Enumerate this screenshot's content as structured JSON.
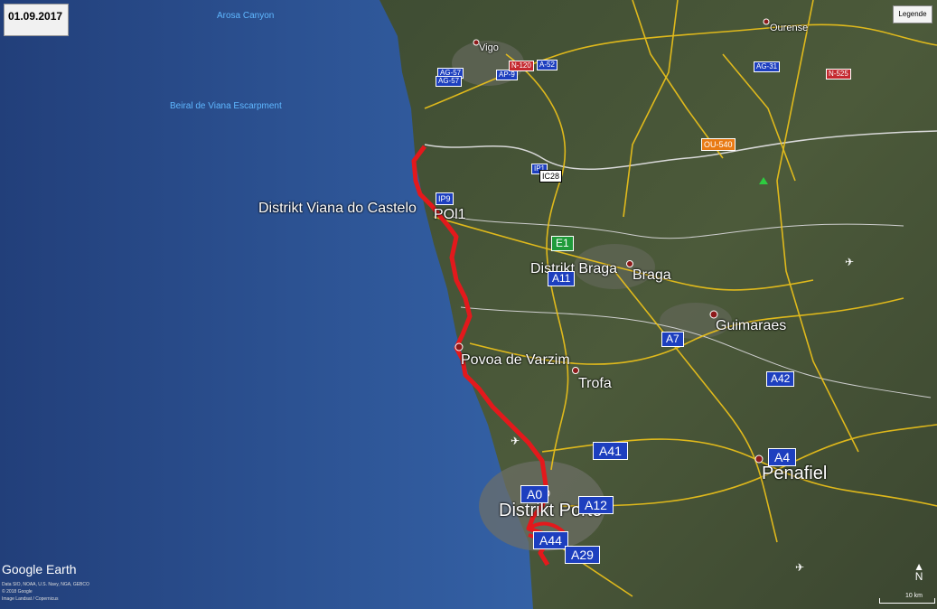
{
  "date": "01.09.2017",
  "legend_label": "Legende",
  "branding": "Google Earth",
  "credits": [
    "Data SIO, NOAA, U.S. Navy, NGA, GEBCO",
    "© 2018 Google",
    "Image Landsat / Copernicus"
  ],
  "scale_label": "10 km",
  "north_label": "N",
  "ocean_labels": [
    "Arosa Canyon",
    "Beiral de Viana Escarpment"
  ],
  "places": {
    "vigo": "Vigo",
    "ourense": "Ourense",
    "viana": "Distrikt Viana do Castelo",
    "braga_district": "Distrikt Braga",
    "braga": "Braga",
    "guimaraes": "Guimaraes",
    "povoa": "Povoa de Varzim",
    "trofa": "Trofa",
    "penafiel": "Penafiel",
    "porto_district": "Distrikt Porto"
  },
  "road_shields": {
    "a52": "A-52",
    "ag57": "AG-57",
    "ag57b": "AG-57",
    "ap9": "AP-9",
    "ag31": "AG-31",
    "n525": "N-525",
    "n120": "N-120",
    "ou540": "OU-540",
    "ic28": "IC28",
    "ip1": "IP1",
    "e1": "E1",
    "pol1": "POl1",
    "a11": "A11",
    "a7": "A7",
    "a42": "A42",
    "a41": "A41",
    "a4": "A4",
    "a0": "A0",
    "a12": "A12",
    "a44": "A44",
    "a29": "A29",
    "ip9": "IP9"
  },
  "colors": {
    "route": "#e3191c",
    "roads": "#f0c419",
    "borders": "#d8d8d8"
  }
}
